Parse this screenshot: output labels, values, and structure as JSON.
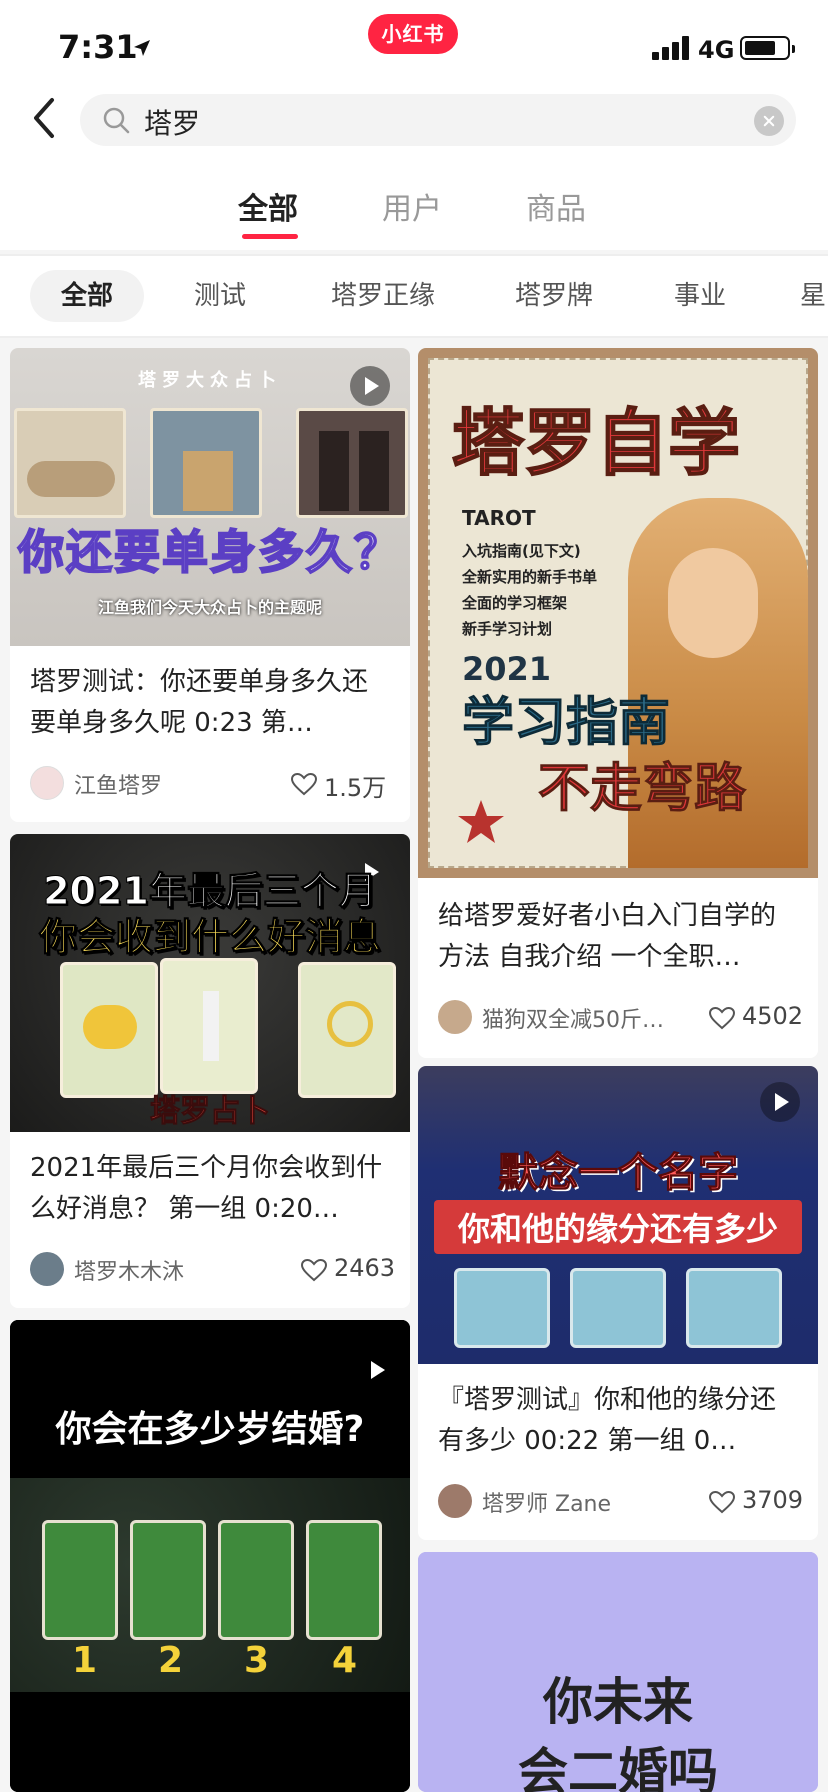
{
  "status_bar": {
    "time": "7:31",
    "network": "4G"
  },
  "brand": "小红书",
  "search": {
    "query": "塔罗"
  },
  "main_tabs": [
    "全部",
    "用户",
    "商品"
  ],
  "filter_chips": [
    "全部",
    "测试",
    "塔罗正缘",
    "塔罗牌",
    "事业",
    "星"
  ],
  "cards": [
    {
      "thumb_top": "塔罗大众占卜",
      "thumb_title": "你还要单身多久？",
      "thumb_caption": "江鱼我们今天大众占卜的主题呢",
      "title": "塔罗测试：你还要单身多久还要单身多久呢 0:23 第…",
      "author": "江鱼塔罗",
      "likes": "1.5万"
    },
    {
      "thumb_title": "塔罗自学",
      "thumb_sub": "TAROT",
      "thumb_lines": [
        "入坑指南(见下文)",
        "全新实用的新手书单",
        "全面的学习框架",
        "新手学习计划"
      ],
      "thumb_year": "2021",
      "thumb_big1": "学习指南",
      "thumb_big2": "不走弯路",
      "title": "给塔罗爱好者小白入门自学的方法 自我介绍 一个全职…",
      "author": "猫狗双全减50斤…",
      "likes": "4502"
    },
    {
      "thumb_title1": "2021年最后三个月",
      "thumb_title2": "你会收到什么好消息",
      "thumb_bottom": "塔罗占卜",
      "title": "2021年最后三个月你会收到什么好消息？ 第一组 0:20…",
      "author": "塔罗木木沐",
      "likes": "2463"
    },
    {
      "thumb_title1": "默念一个名字",
      "thumb_title2": "你和他的缘分还有多少",
      "title": "『塔罗测试』你和他的缘分还有多少 00:22 第一组 0…",
      "author": "塔罗师 Zane",
      "likes": "3709"
    },
    {
      "thumb_title": "你会在多少岁结婚?",
      "thumb_numbers": [
        "1",
        "2",
        "3",
        "4"
      ]
    },
    {
      "thumb_title1": "你未来",
      "thumb_title2": "会二婚吗"
    }
  ],
  "colors": {
    "accent": "#ff2442"
  }
}
